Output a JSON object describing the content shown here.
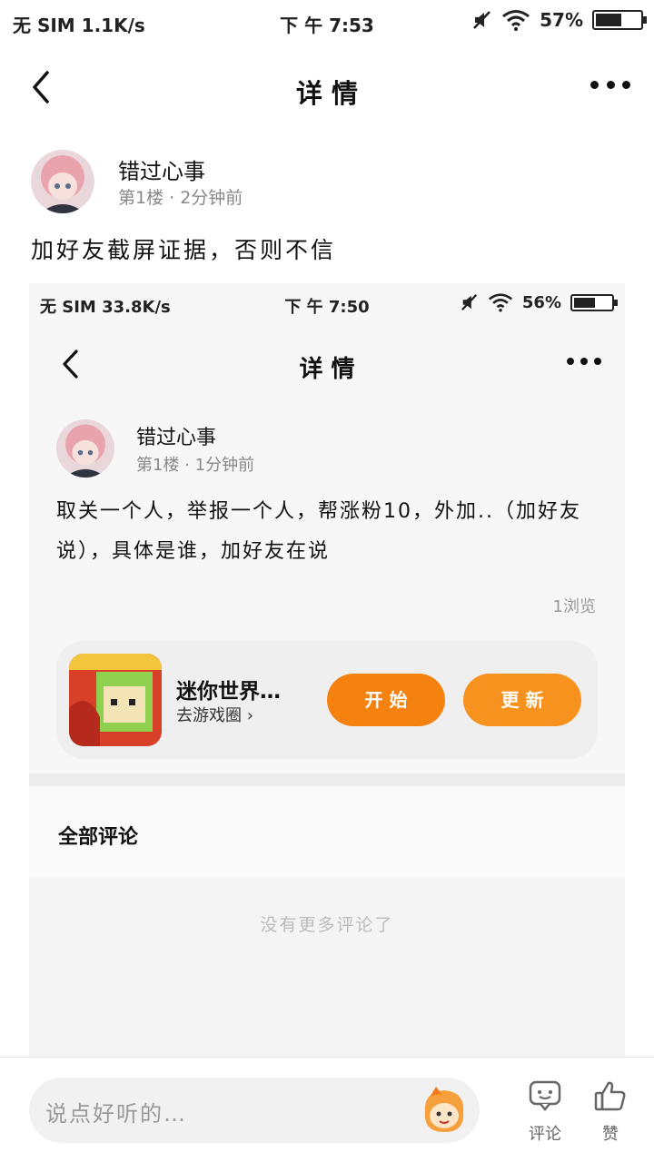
{
  "status_bar": {
    "carrier": "无 SIM 1.1K/s",
    "time": "下 午 7:53",
    "battery": "57%",
    "battery_level": 0.57
  },
  "header": {
    "title": "详 情"
  },
  "post": {
    "author_name": "错过心事",
    "floor": "第1楼",
    "time_ago": "· 2分钟前",
    "text": "加好友截屏证据，否则不信"
  },
  "screenshot": {
    "status_bar": {
      "carrier": "无 SIM 33.8K/s",
      "time": "下 午 7:50",
      "battery": "56%",
      "battery_level": 0.56
    },
    "header": {
      "title": "详 情"
    },
    "post": {
      "author_name": "错过心事",
      "floor": "第1楼",
      "time_ago": "· 1分钟前",
      "text": "取关一个人，举报一个人，帮涨粉10，外加..（加好友说），具体是谁，加好友在说",
      "views": "1浏览"
    },
    "game_card": {
      "name": "迷你世界…",
      "link": "去游戏圈 ›",
      "start_label": "开 始",
      "update_label": "更 新"
    },
    "comments": {
      "title": "全部评论",
      "empty_text": "没有更多评论了"
    }
  },
  "bottom_bar": {
    "input_placeholder": "说点好听的…",
    "comment_label": "评论",
    "like_label": "赞"
  },
  "colors": {
    "accent_orange": "#f5820f",
    "text_gray": "#888888"
  }
}
